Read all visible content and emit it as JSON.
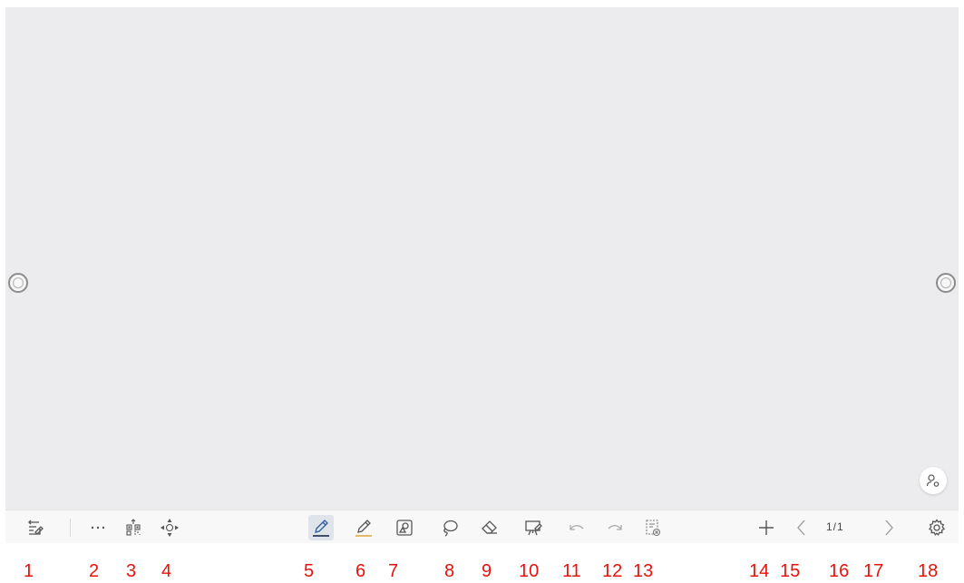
{
  "toolbar": {
    "page_indicator": "1/1"
  },
  "annotation_labels": [
    "1",
    "2",
    "3",
    "4",
    "5",
    "6",
    "7",
    "8",
    "9",
    "10",
    "11",
    "12",
    "13",
    "14",
    "15",
    "16",
    "17",
    "18"
  ],
  "colors": {
    "canvas": "#ececee",
    "toolbar": "#f8f8f9",
    "label": "#e8120c",
    "pen_underline": "#2c5a9a",
    "highlighter_underline": "#e8b86a"
  },
  "icons": [
    "exit-whiteboard-icon",
    "more-icon",
    "qr-code-icon",
    "move-toolbar-icon",
    "pen-icon",
    "highlighter-icon",
    "image-shape-icon",
    "lasso-icon",
    "eraser-icon",
    "present-icon",
    "undo-icon",
    "redo-icon",
    "clear-page-icon",
    "add-page-icon",
    "prev-page-icon",
    "next-page-icon",
    "settings-icon",
    "user-icon"
  ]
}
